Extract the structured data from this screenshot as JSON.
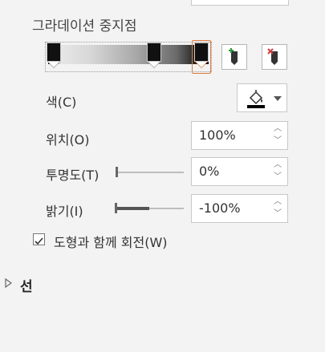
{
  "gradient_stops_section": {
    "label": "그라데이션 중지점",
    "add_stop_button": "add-gradient-stop",
    "remove_stop_button": "remove-gradient-stop"
  },
  "color": {
    "label": "색(C)",
    "swatch_hex": "#000000"
  },
  "position": {
    "label": "위치(O)",
    "value": "100%"
  },
  "transparency": {
    "label": "투명도(T)",
    "value": "0%",
    "level": 0
  },
  "brightness": {
    "label": "밝기(I)",
    "value": "-100%",
    "level": -1.0
  },
  "rotate_with_shape": {
    "label": "도형과 함께 회전(W)",
    "checked": true
  },
  "line_section": {
    "title": "선",
    "expanded": false
  },
  "colors": {
    "accent_orange": "#e07a3a",
    "background": "#f3f3f3",
    "border": "#c8c8c8"
  }
}
